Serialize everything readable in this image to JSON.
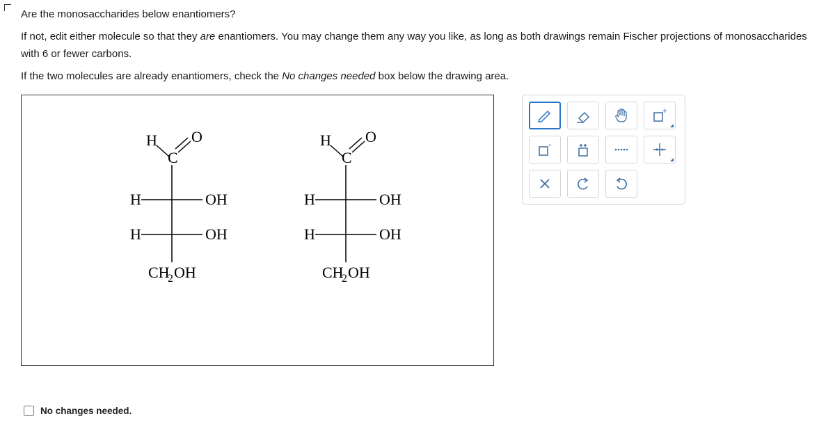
{
  "question": {
    "line1": "Are the monosaccharides below enantiomers?",
    "line2_a": "If not, edit either molecule so that they ",
    "line2_b": "are",
    "line2_c": " enantiomers. You may change them any way you like, as long as both drawings remain Fischer projections of monosaccharides with 6 or fewer carbons.",
    "line3_a": "If the two molecules are already enantiomers, check the ",
    "line3_b": "No changes needed",
    "line3_c": " box below the drawing area."
  },
  "molecule1": {
    "top_left": "H",
    "top_right": "O",
    "top_c": "C",
    "row1_left": "H",
    "row1_right": "OH",
    "row2_left": "H",
    "row2_right": "OH",
    "bottom": "CH",
    "bottom_sub": "2",
    "bottom_oh": "OH"
  },
  "molecule2": {
    "top_left": "H",
    "top_right": "O",
    "top_c": "C",
    "row1_left": "H",
    "row1_right": "OH",
    "row2_left": "H",
    "row2_right": "OH",
    "bottom": "CH",
    "bottom_sub": "2",
    "bottom_oh": "OH"
  },
  "tools": {
    "draw": "draw-icon",
    "erase": "erase-icon",
    "move": "move-icon",
    "charge_plus": "charge-plus-icon",
    "charge_minus": "charge-minus-icon",
    "lone_pair": "lone-pair-icon",
    "dots": "radical-icon",
    "chiral": "chiral-icon",
    "delete": "delete-icon",
    "undo": "undo-icon",
    "redo": "redo-icon"
  },
  "checkbox_label": "No changes needed."
}
